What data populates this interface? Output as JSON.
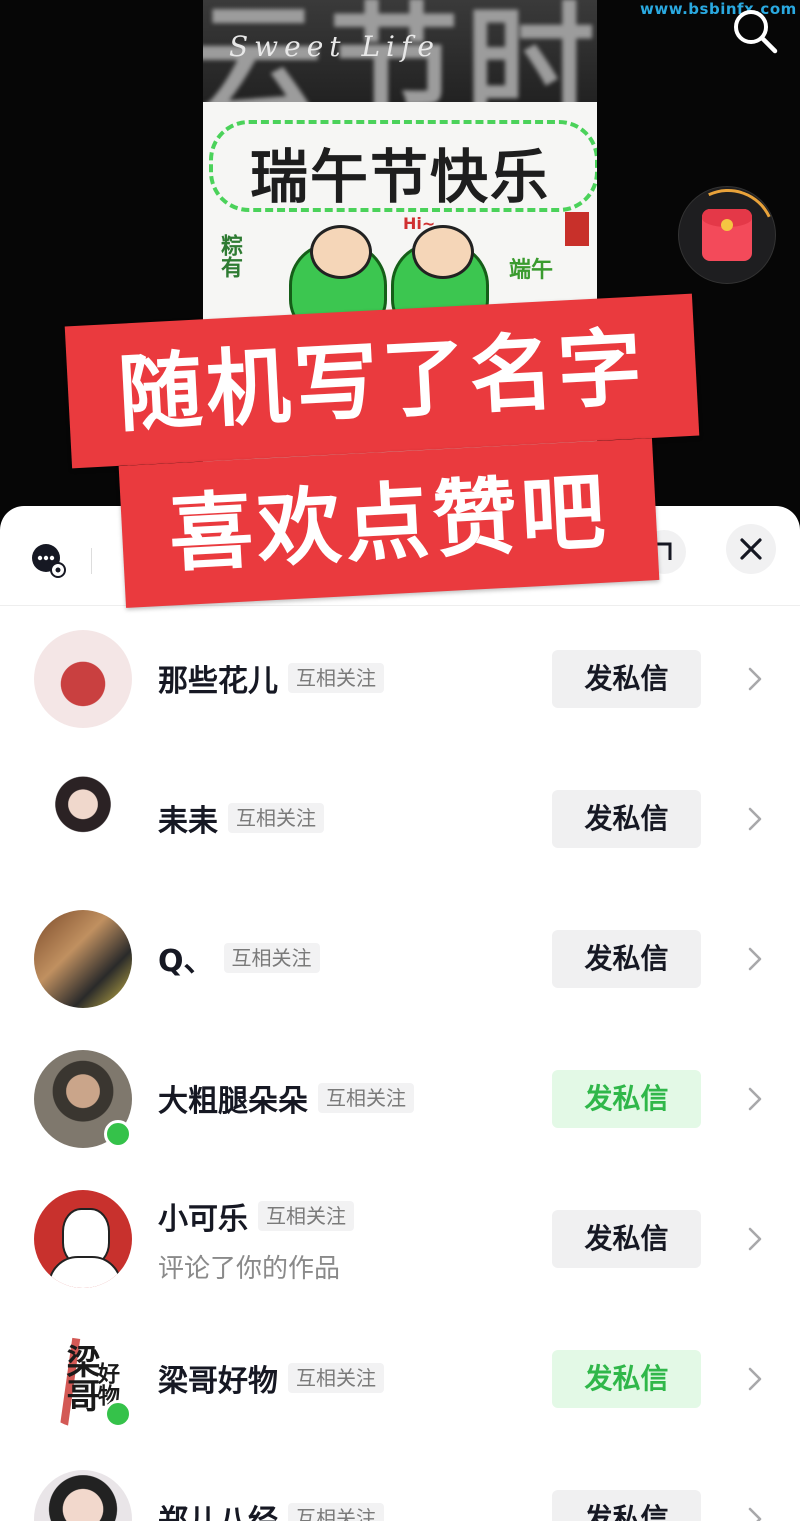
{
  "watermark": "www.bsbinfx.com",
  "video": {
    "card_strip_text": "Sweet Life",
    "card_title": "瑞午节快乐",
    "hand_left": "粽有",
    "hand_right": "端午",
    "hand_hi": "Hi~",
    "search_icon": "search-icon",
    "redpacket_icon": "red-envelope-icon"
  },
  "overlay": {
    "line1": "随机写了名字",
    "line2": "喜欢点赞吧"
  },
  "sheet": {
    "more_icon": "chat-more-settings-icon",
    "frame_icon": "expand-frame-icon",
    "close_icon": "close-icon"
  },
  "contacts": [
    {
      "name": "那些花儿",
      "tag": "互相关注",
      "subtitle": "",
      "button": "发私信",
      "button_style": "gray",
      "online": false,
      "avatar": "av1"
    },
    {
      "name": "耒耒",
      "tag": "互相关注",
      "subtitle": "",
      "button": "发私信",
      "button_style": "gray",
      "online": false,
      "avatar": "av2"
    },
    {
      "name": "Q、",
      "tag": "互相关注",
      "subtitle": "",
      "button": "发私信",
      "button_style": "gray",
      "online": false,
      "avatar": "av3"
    },
    {
      "name": "大粗腿朵朵",
      "tag": "互相关注",
      "subtitle": "",
      "button": "发私信",
      "button_style": "green",
      "online": true,
      "avatar": "av4"
    },
    {
      "name": "小可乐",
      "tag": "互相关注",
      "subtitle": "评论了你的作品",
      "button": "发私信",
      "button_style": "gray",
      "online": false,
      "avatar": "av5"
    },
    {
      "name": "梁哥好物",
      "tag": "互相关注",
      "subtitle": "",
      "button": "发私信",
      "button_style": "green",
      "online": true,
      "avatar": "av6"
    },
    {
      "name": "郑儿八经",
      "tag": "互相关注",
      "subtitle": "",
      "button": "发私信",
      "button_style": "gray",
      "online": false,
      "avatar": "av7"
    }
  ],
  "av6_text": {
    "c1": "梁哥",
    "c2": "好物"
  }
}
